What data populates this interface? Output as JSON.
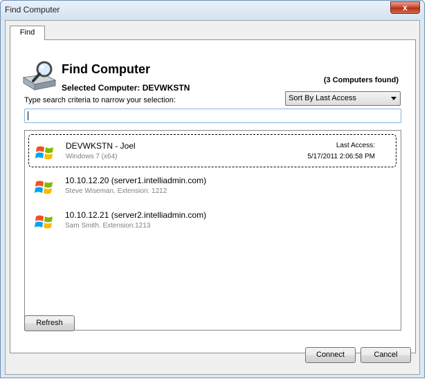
{
  "window": {
    "title": "Find Computer",
    "close_label": "x"
  },
  "tabs": [
    {
      "label": "Find"
    }
  ],
  "header": {
    "icon": "computer-search-icon",
    "title": "Find Computer",
    "selected_computer": "Selected Computer: DEVWKSTN"
  },
  "results": {
    "count_text": "(3 Computers found)"
  },
  "sort": {
    "selected": "Sort By Last Access"
  },
  "search": {
    "label": "Type search criteria to narrow your selection:",
    "value": "",
    "placeholder": ""
  },
  "computers": [
    {
      "icon": "windows-logo-icon",
      "name": "DEVWKSTN - Joel",
      "detail": "Windows 7 (x64)",
      "last_access_label": "Last Access:",
      "last_access_time": "5/17/2011 2:06:58 PM",
      "selected": true
    },
    {
      "icon": "windows-logo-icon",
      "name": "10.10.12.20 (server1.intelliadmin.com)",
      "detail": "Steve Wiseman. Extension: 1212",
      "selected": false
    },
    {
      "icon": "windows-logo-icon",
      "name": "10.10.12.21 (server2.intelliadmin.com)",
      "detail": "Sam Smith. Extension:1213",
      "selected": false
    }
  ],
  "buttons": {
    "refresh": "Refresh",
    "connect": "Connect",
    "cancel": "Cancel"
  },
  "colors": {
    "windows_red": "#f25022",
    "windows_green": "#7fba00",
    "windows_blue": "#00a4ef",
    "windows_yellow": "#ffb900"
  }
}
